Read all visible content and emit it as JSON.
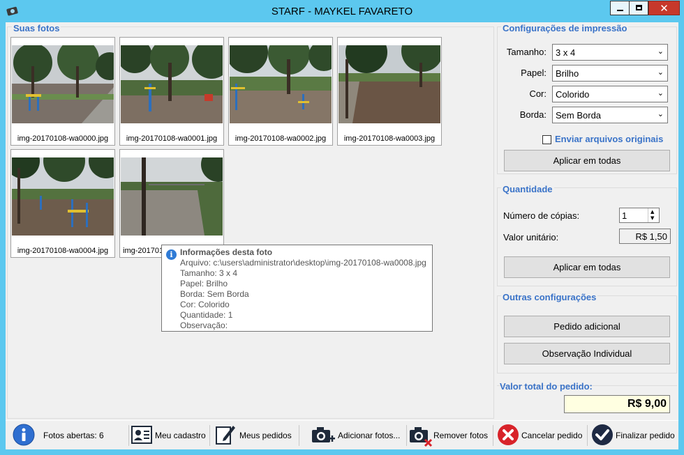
{
  "window": {
    "title": "STARF - MAYKEL FAVARETO",
    "close_glyph": "✕"
  },
  "photos": {
    "title": "Suas fotos",
    "items": [
      {
        "filename": "img-20170108-wa0000.jpg"
      },
      {
        "filename": "img-20170108-wa0001.jpg"
      },
      {
        "filename": "img-20170108-wa0002.jpg"
      },
      {
        "filename": "img-20170108-wa0003.jpg"
      },
      {
        "filename": "img-20170108-wa0004.jpg"
      },
      {
        "filename": "img-20170108-wa0008.jpg",
        "visible_caption": "img-2017010"
      }
    ]
  },
  "tooltip": {
    "icon": "i",
    "title": "Informações desta foto",
    "lines": [
      "Arquivo: c:\\users\\administrator\\desktop\\img-20170108-wa0008.jpg",
      "Tamanho: 3 x 4",
      "Papel: Brilho",
      "Borda: Sem Borda",
      "Cor: Colorido",
      "Quantidade: 1",
      "Observação:"
    ]
  },
  "print_settings": {
    "title": "Configurações de impressão",
    "size_label": "Tamanho:",
    "size_value": "3 x 4",
    "paper_label": "Papel:",
    "paper_value": "Brilho",
    "color_label": "Cor:",
    "color_value": "Colorido",
    "border_label": "Borda:",
    "border_value": "Sem Borda",
    "send_originals_label": "Enviar arquivos originais",
    "send_originals_checked": false,
    "apply_all_label": "Aplicar em todas"
  },
  "quantity": {
    "title": "Quantidade",
    "copies_label": "Número de cópias:",
    "copies_value": "1",
    "unit_label": "Valor unitário:",
    "unit_value": "R$ 1,50",
    "apply_all_label": "Aplicar em todas"
  },
  "other": {
    "title": "Outras configurações",
    "additional_order_label": "Pedido adicional",
    "individual_note_label": "Observação Individual"
  },
  "total": {
    "title": "Valor total do pedido:",
    "value": "R$ 9,00"
  },
  "toolbar": {
    "photos_open": "Fotos abertas: 6",
    "my_account": "Meu cadastro",
    "my_orders": "Meus pedidos",
    "add_photos": "Adicionar fotos...",
    "remove_photos": "Remover fotos",
    "cancel_order": "Cancelar pedido",
    "finish_order": "Finalizar pedido"
  },
  "colors": {
    "titlebar": "#5cc8ef",
    "accent_text": "#3a73c8",
    "close": "#c7382b",
    "total_bg": "#ffffe1"
  }
}
